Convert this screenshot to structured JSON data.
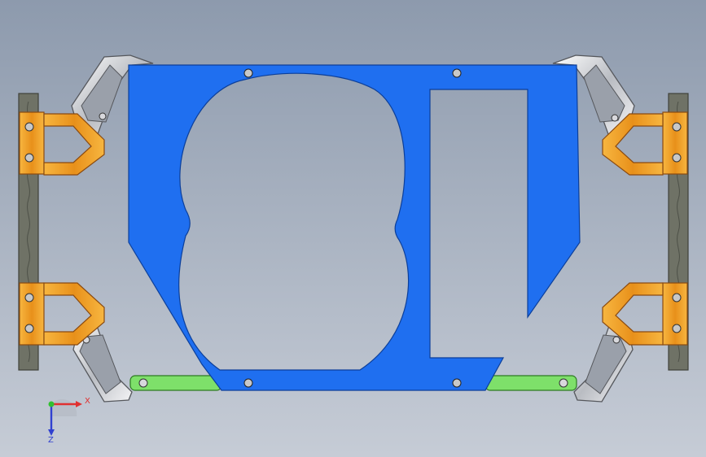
{
  "viewport": {
    "background_top": "#8d9aad",
    "background_bottom": "#c6ccd6"
  },
  "colors": {
    "plate": "#1f6ff0",
    "plate_stroke": "#0c3f9a",
    "clamp_orange": "#f0a020",
    "clamp_dark": "#8a4a10",
    "rail": "#6f7266",
    "rail_dark": "#3f413a",
    "green_link": "#7ee06a",
    "green_dark": "#2d7a22",
    "chrome": "#e8e8ea",
    "chrome_dark": "#55575c"
  },
  "triad": {
    "x_label": "X",
    "z_label": "Z",
    "x_color": "#e03030",
    "z_color": "#3040d0",
    "y_color": "#30c030"
  }
}
